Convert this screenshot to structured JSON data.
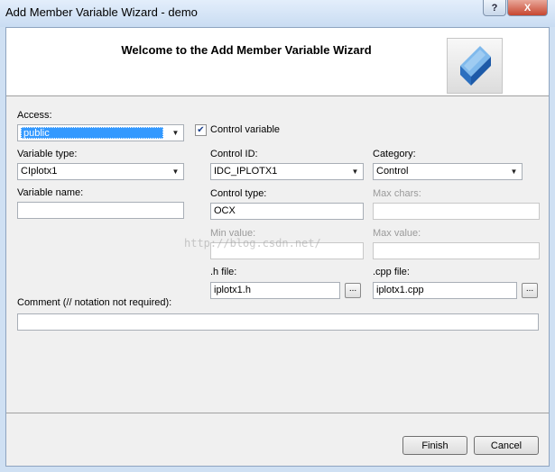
{
  "window": {
    "title": "Add Member Variable Wizard - demo",
    "help_label": "?",
    "close_label": "X"
  },
  "header": {
    "title": "Welcome to the Add Member Variable Wizard"
  },
  "form": {
    "access": {
      "label": "Access:",
      "value": "public"
    },
    "control_variable": {
      "label": "Control variable",
      "checked": true
    },
    "variable_type": {
      "label": "Variable type:",
      "value": "CIplotx1"
    },
    "control_id": {
      "label": "Control ID:",
      "value": "IDC_IPLOTX1"
    },
    "category": {
      "label": "Category:",
      "value": "Control"
    },
    "variable_name": {
      "label": "Variable name:",
      "value": ""
    },
    "control_type": {
      "label": "Control type:",
      "value": "OCX"
    },
    "max_chars": {
      "label": "Max chars:",
      "value": ""
    },
    "min_value": {
      "label": "Min value:",
      "value": ""
    },
    "max_value": {
      "label": "Max value:",
      "value": ""
    },
    "h_file": {
      "label": ".h file:",
      "value": "iplotx1.h"
    },
    "cpp_file": {
      "label": ".cpp file:",
      "value": "iplotx1.cpp"
    },
    "browse_label": "...",
    "comment": {
      "label": "Comment (// notation not required):",
      "value": ""
    }
  },
  "watermark": "http://blog.csdn.net/",
  "buttons": {
    "finish": "Finish",
    "cancel": "Cancel"
  },
  "icons": {
    "wizard_logo": "blue-cube-icon",
    "dropdown": "chevron-down-icon",
    "checkmark": "checkmark-icon"
  }
}
